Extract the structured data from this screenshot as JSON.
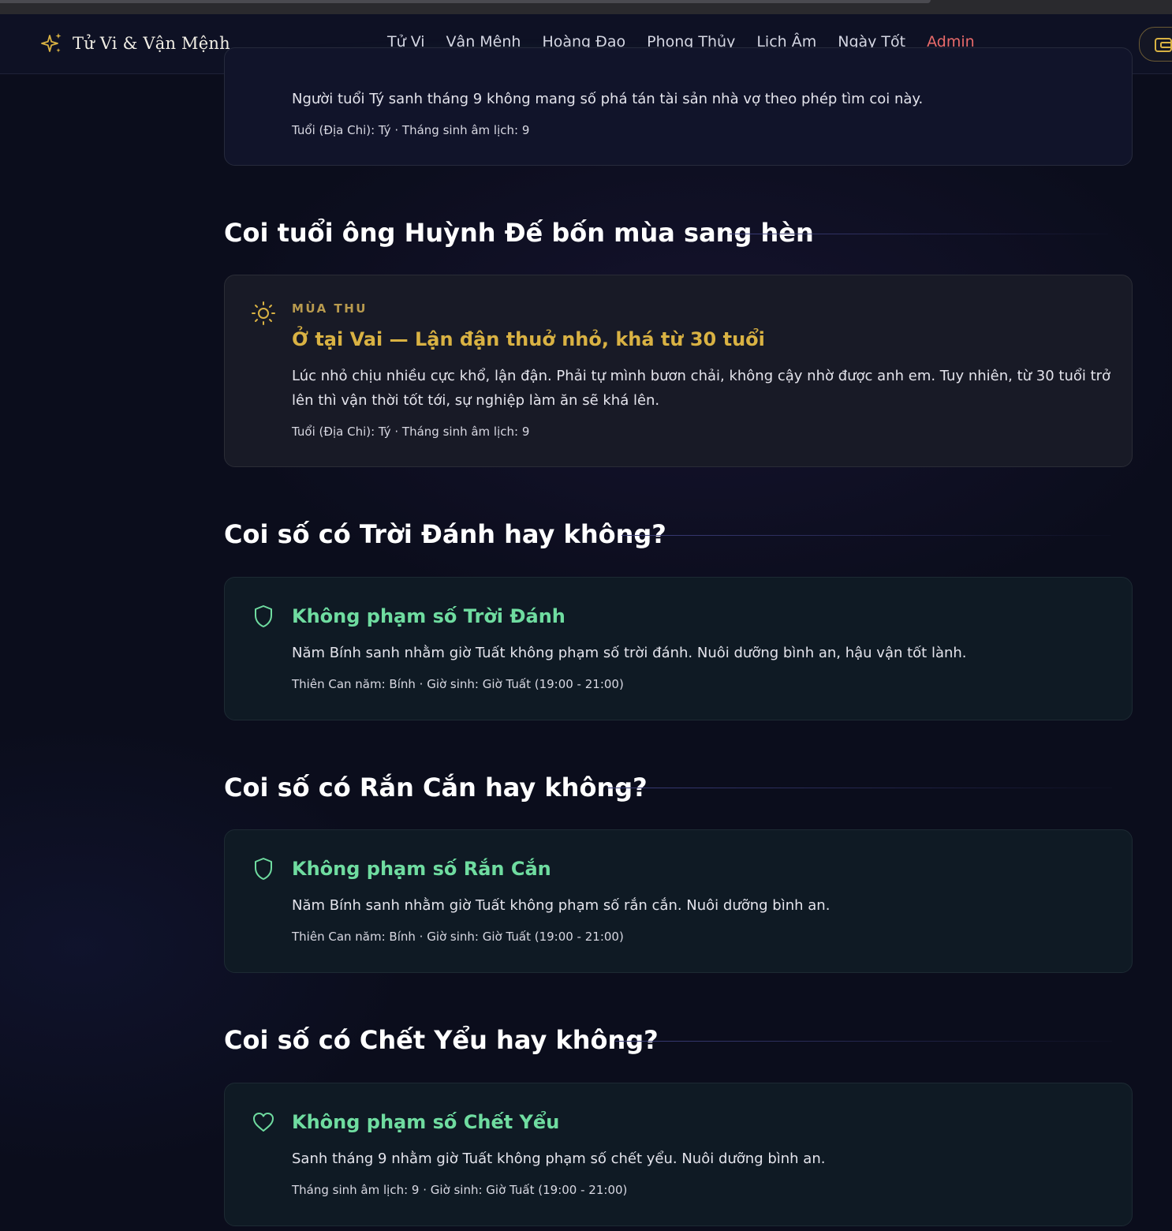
{
  "brand": {
    "name": "Tử Vi & Vận Mệnh",
    "icon": "sparkles-icon"
  },
  "nav": {
    "items": [
      "Tử Vi",
      "Vận Mệnh",
      "Hoàng Đạo",
      "Phong Thủy",
      "Lịch Âm",
      "Ngày Tốt"
    ],
    "admin": "Admin"
  },
  "colors": {
    "gold": "#d9b243",
    "green": "#6fdca0",
    "admin": "#e86a6a"
  },
  "top_card": {
    "body": "Người tuổi Tý sanh tháng 9 không mang số phá tán tài sản nhà vợ theo phép tìm coi này.",
    "meta": "Tuổi (Địa Chi): Tý · Tháng sinh âm lịch: 9"
  },
  "sections": [
    {
      "title": "Coi tuổi ông Huỳnh Đế bốn mùa sang hèn",
      "card": {
        "icon": "sun-icon",
        "eyebrow": "MÙA THU",
        "title": "Ở tại Vai — Lận đận thuở nhỏ, khá từ 30 tuổi",
        "body": "Lúc nhỏ chịu nhiều cực khổ, lận đận. Phải tự mình bươn chải, không cậy nhờ được anh em. Tuy nhiên, từ 30 tuổi trở lên thì vận thời tốt tới, sự nghiệp làm ăn sẽ khá lên.",
        "meta": "Tuổi (Địa Chi): Tý · Tháng sinh âm lịch: 9"
      }
    },
    {
      "title": "Coi số có Trời Đánh hay không?",
      "card": {
        "icon": "shield-icon",
        "title": "Không phạm số Trời Đánh",
        "body": "Năm Bính sanh nhằm giờ Tuất không phạm số trời đánh. Nuôi dưỡng bình an, hậu vận tốt lành.",
        "meta": "Thiên Can năm: Bính · Giờ sinh: Giờ Tuất (19:00 - 21:00)"
      }
    },
    {
      "title": "Coi số có Rắn Cắn hay không?",
      "card": {
        "icon": "shield-icon",
        "title": "Không phạm số Rắn Cắn",
        "body": "Năm Bính sanh nhằm giờ Tuất không phạm số rắn cắn. Nuôi dưỡng bình an.",
        "meta": "Thiên Can năm: Bính · Giờ sinh: Giờ Tuất (19:00 - 21:00)"
      }
    },
    {
      "title": "Coi số có Chết Yểu hay không?",
      "card": {
        "icon": "heart-icon",
        "title": "Không phạm số Chết Yểu",
        "body": "Sanh tháng 9 nhằm giờ Tuất không phạm số chết yểu. Nuôi dưỡng bình an.",
        "meta": "Tháng sinh âm lịch: 9 · Giờ sinh: Giờ Tuất (19:00 - 21:00)"
      }
    }
  ]
}
